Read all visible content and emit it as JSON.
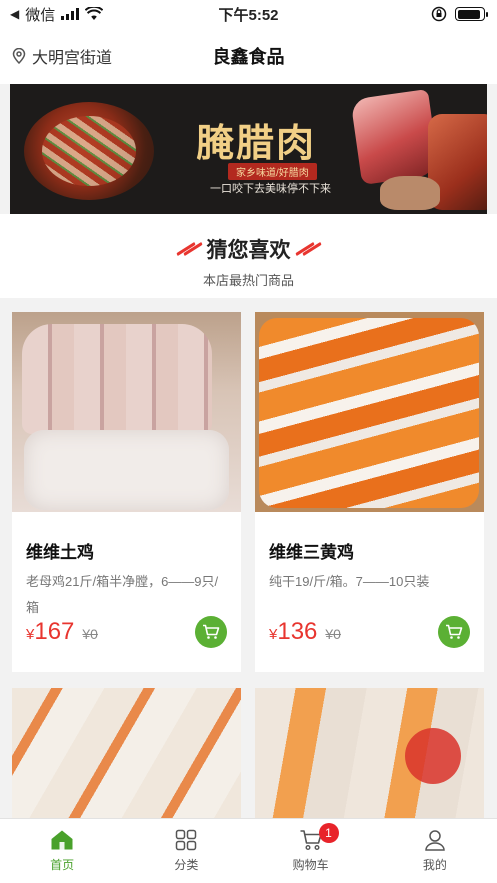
{
  "status_bar": {
    "carrier": "微信",
    "time": "下午5:52",
    "battery_level": 0.9
  },
  "nav": {
    "location": "大明宫街道",
    "title": "良鑫食品"
  },
  "banner": {
    "title": "腌腊肉",
    "tag": "家乡味道/好腊肉",
    "slogan": "一口咬下去美味停不下来"
  },
  "section": {
    "title": "猜您喜欢",
    "subtitle": "本店最热门商品"
  },
  "products": [
    {
      "name": "维维土鸡",
      "desc": "老母鸡21斤/箱半净膛，6——9只/箱",
      "currency": "¥",
      "price": "167",
      "old_price": "¥0"
    },
    {
      "name": "维维三黄鸡",
      "desc": "纯干19/斤/箱。7——10只装",
      "currency": "¥",
      "price": "136",
      "old_price": "¥0"
    },
    {
      "name": "",
      "desc": ""
    },
    {
      "name": "",
      "desc": ""
    }
  ],
  "tabbar": {
    "items": [
      {
        "label": "首页"
      },
      {
        "label": "分类"
      },
      {
        "label": "购物车"
      },
      {
        "label": "我的"
      }
    ],
    "cart_badge": "1"
  },
  "colors": {
    "accent_green": "#49a12b",
    "price_red": "#e8352f",
    "badge_red": "#e8232a"
  }
}
